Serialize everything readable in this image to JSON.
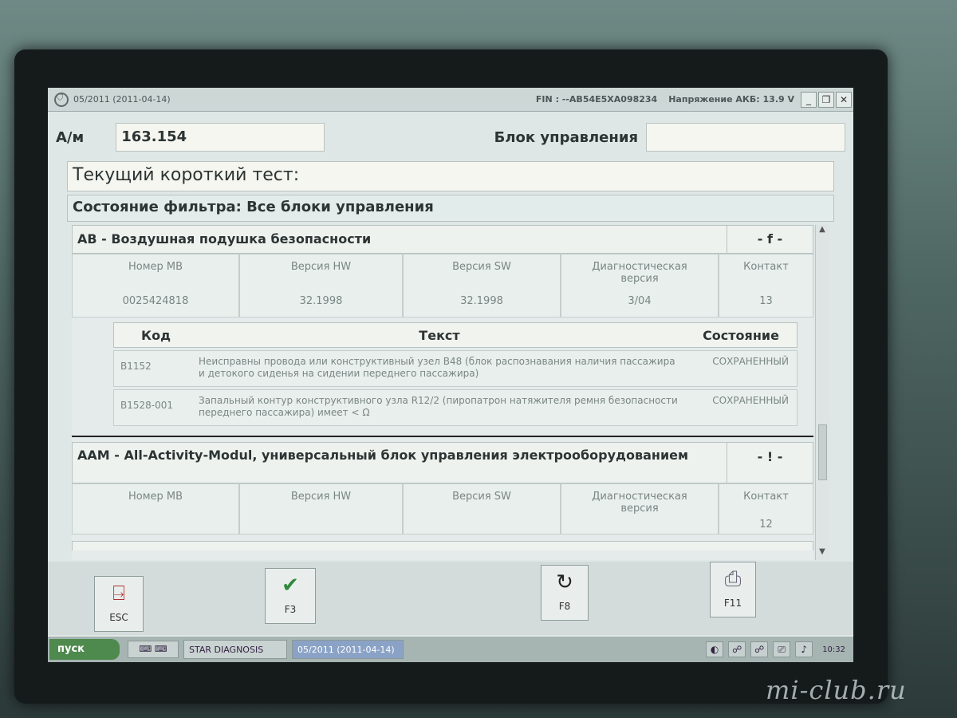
{
  "window": {
    "title": "05/2011 (2011-04-14)",
    "fin": "FIN : --AB54E5XA098234",
    "voltage": "Напряжение АКБ: 13.9 V",
    "buttons": [
      "_",
      "❐",
      "✕"
    ]
  },
  "header": {
    "am_label": "А/м",
    "am_value": "163.154",
    "unit_label": "Блок управления",
    "unit_value": ""
  },
  "test_line": "Текущий короткий тест:",
  "filter_line": "Состояние фильтра: Все блоки управления",
  "info_headers": [
    "Номер MB",
    "Версия HW",
    "Версия SW",
    "Диагностическая версия",
    "Контакт"
  ],
  "units": [
    {
      "name": "AB - Воздушная подушка безопасности",
      "status": "- f -",
      "info_values": [
        "0025424818",
        "32.1998",
        "32.1998",
        "3/04",
        "13"
      ],
      "code_headers": [
        "Код",
        "Текст",
        "Состояние"
      ],
      "codes": [
        {
          "code": "B1152",
          "text": "Неисправны провода или конструктивный узел B48 (блок распознавания наличия пассажира и детокого сиденья на сидении переднего пассажира)",
          "state": "СОХРАНЕННЫЙ"
        },
        {
          "code": "B1528-001",
          "text": "Запальный контур конструктивного узла R12/2 (пиропатрон натяжителя ремня безопасности переднего пассажира) имеет < Ω",
          "state": "СОХРАНЕННЫЙ"
        }
      ]
    },
    {
      "name": "AAM - All-Activity-Modul, универсальный блок управления электрооборудованием",
      "status": "- ! -",
      "info_values": [
        "",
        "",
        "",
        "",
        "12"
      ]
    }
  ],
  "fkeys": {
    "esc": "ESC",
    "f3": "F3",
    "f8": "F8",
    "f11": "F11"
  },
  "taskbar": {
    "start": "пуск",
    "task1": "STAR DIAGNOSIS",
    "task2": "05/2011 (2011-04-14)",
    "clock": "10:32"
  },
  "watermark": "mi-club.ru"
}
